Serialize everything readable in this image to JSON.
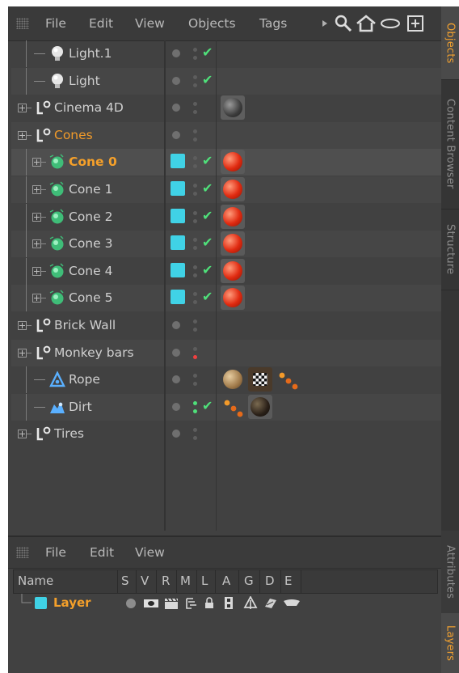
{
  "object_manager": {
    "menu": [
      "File",
      "Edit",
      "View",
      "Objects",
      "Tags"
    ],
    "objects": [
      {
        "name": "Light.1",
        "icon": "light-bulb-icon",
        "depth": 1,
        "expand": false,
        "style": "normal",
        "swatch": false,
        "check": true,
        "tags": []
      },
      {
        "name": "Light",
        "icon": "light-bulb-icon",
        "depth": 1,
        "expand": false,
        "style": "normal",
        "swatch": false,
        "check": true,
        "tags": []
      },
      {
        "name": "Cinema 4D",
        "icon": "null-object-icon",
        "depth": 0,
        "expand": true,
        "style": "normal",
        "swatch": false,
        "check": false,
        "tags": [
          "material-grey"
        ]
      },
      {
        "name": "Cones",
        "icon": "null-object-icon",
        "depth": 0,
        "expand": true,
        "style": "orange",
        "swatch": false,
        "check": false,
        "tags": []
      },
      {
        "name": "Cone 0",
        "icon": "cone-object-icon",
        "depth": 1,
        "expand": true,
        "style": "selected",
        "swatch": true,
        "check": true,
        "tags": [
          "material-red"
        ]
      },
      {
        "name": "Cone 1",
        "icon": "cone-object-icon",
        "depth": 1,
        "expand": true,
        "style": "normal",
        "swatch": true,
        "check": true,
        "tags": [
          "material-red"
        ]
      },
      {
        "name": "Cone 2",
        "icon": "cone-object-icon",
        "depth": 1,
        "expand": true,
        "style": "normal",
        "swatch": true,
        "check": true,
        "tags": [
          "material-red"
        ]
      },
      {
        "name": "Cone 3",
        "icon": "cone-object-icon",
        "depth": 1,
        "expand": true,
        "style": "normal",
        "swatch": true,
        "check": true,
        "tags": [
          "material-red"
        ]
      },
      {
        "name": "Cone 4",
        "icon": "cone-object-icon",
        "depth": 1,
        "expand": true,
        "style": "normal",
        "swatch": true,
        "check": true,
        "tags": [
          "material-red"
        ]
      },
      {
        "name": "Cone 5",
        "icon": "cone-object-icon",
        "depth": 1,
        "expand": true,
        "style": "normal",
        "swatch": true,
        "check": true,
        "tags": [
          "material-red"
        ]
      },
      {
        "name": "Brick Wall",
        "icon": "null-object-icon",
        "depth": 0,
        "expand": true,
        "style": "normal",
        "swatch": false,
        "check": false,
        "tags": []
      },
      {
        "name": "Monkey bars",
        "icon": "null-object-icon",
        "depth": 0,
        "expand": true,
        "style": "normal",
        "swatch": false,
        "check": false,
        "tags": [],
        "vis_red": true
      },
      {
        "name": "Rope",
        "icon": "rope-spline-icon",
        "depth": 1,
        "expand": false,
        "style": "normal",
        "swatch": false,
        "check": false,
        "tags": [
          "material-tan",
          "material-checker",
          "dynamics-particles"
        ]
      },
      {
        "name": "Dirt",
        "icon": "dirt-object-icon",
        "depth": 1,
        "expand": false,
        "style": "normal",
        "swatch": false,
        "check": true,
        "vis_green": true,
        "tags": [
          "dynamics-particles",
          "material-dark"
        ]
      },
      {
        "name": "Tires",
        "icon": "null-object-icon",
        "depth": 0,
        "expand": true,
        "style": "normal",
        "swatch": false,
        "check": false,
        "tags": []
      }
    ]
  },
  "side_tabs": {
    "objects": "Objects",
    "content_browser": "Content Browser",
    "structure": "Structure",
    "attributes": "Attributes",
    "layers": "Layers"
  },
  "layer_manager": {
    "menu": [
      "File",
      "Edit",
      "View"
    ],
    "columns": [
      "Name",
      "S",
      "V",
      "R",
      "M",
      "L",
      "A",
      "G",
      "D",
      "E"
    ],
    "layer": {
      "name": "Layer",
      "color": "#40d2e6"
    }
  },
  "colors": {
    "accent": "#f0a030",
    "swatch": "#40d2e6",
    "check": "#4fe07a",
    "cone": "#40c080"
  }
}
